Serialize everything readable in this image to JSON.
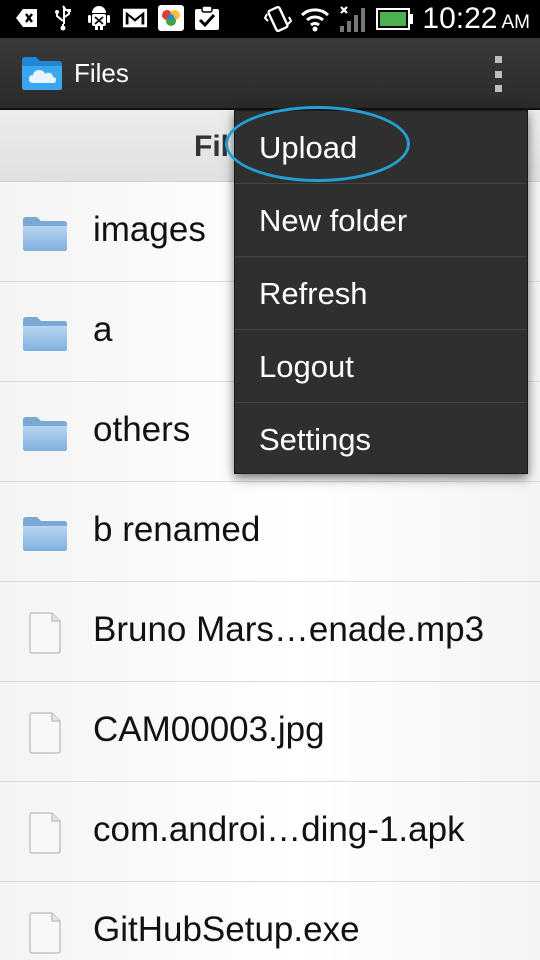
{
  "status_bar": {
    "time": "10:22",
    "ampm": "AM",
    "left_icons": [
      "back-icon",
      "usb-icon",
      "android-debug-icon",
      "gmail-icon",
      "photos-icon",
      "checklist-icon"
    ],
    "right_icons": [
      "vibrate-icon",
      "wifi-icon",
      "signal-icon",
      "battery-icon"
    ]
  },
  "action_bar": {
    "title": "Files",
    "app_icon": "cloud-folder-icon",
    "overflow_icon": "overflow-menu-icon"
  },
  "section_header": {
    "label": "Fil"
  },
  "files": [
    {
      "name": "images",
      "type": "folder"
    },
    {
      "name": "a",
      "type": "folder"
    },
    {
      "name": "others",
      "type": "folder"
    },
    {
      "name": "b renamed",
      "type": "folder"
    },
    {
      "name": "Bruno Mars…enade.mp3",
      "type": "file"
    },
    {
      "name": "CAM00003.jpg",
      "type": "file"
    },
    {
      "name": "com.androi…ding-1.apk",
      "type": "file"
    },
    {
      "name": "GitHubSetup.exe",
      "type": "file"
    }
  ],
  "menu": {
    "items": [
      {
        "label": "Upload"
      },
      {
        "label": "New folder"
      },
      {
        "label": "Refresh"
      },
      {
        "label": "Logout"
      },
      {
        "label": "Settings"
      }
    ]
  },
  "colors": {
    "accent": "#22a0d6",
    "folder": "#8fbbe3",
    "menu_bg": "#2f2f2f",
    "action_bar": "#2f2f2f"
  }
}
